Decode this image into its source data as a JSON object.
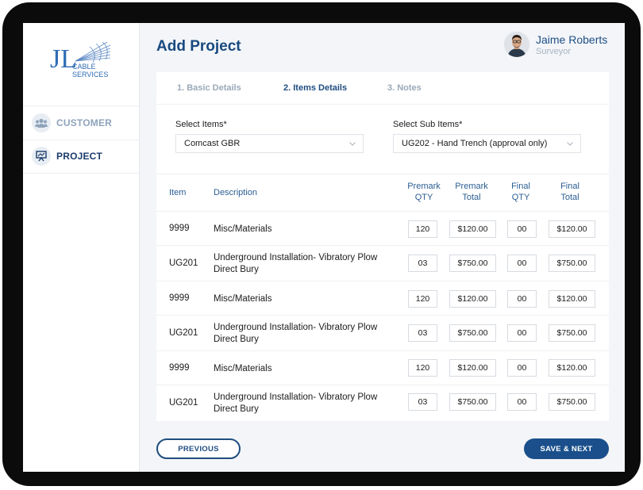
{
  "brand": {
    "logo_letters": "JL",
    "logo_line1": "CABLE",
    "logo_line2": "SERVICES"
  },
  "sidebar": {
    "items": [
      {
        "label": "CUSTOMER",
        "icon": "users-icon"
      },
      {
        "label": "PROJECT",
        "icon": "presentation-icon"
      }
    ]
  },
  "header": {
    "title": "Add Project"
  },
  "user": {
    "name": "Jaime Roberts",
    "role": "Surveyor"
  },
  "tabs": [
    {
      "label": "1. Basic Details"
    },
    {
      "label": "2. Items Details"
    },
    {
      "label": "3. Notes"
    }
  ],
  "form": {
    "items_label": "Select Items*",
    "items_value": "Comcast GBR",
    "subitems_label": "Select Sub Items*",
    "subitems_value": "UG202 - Hand Trench (approval only)"
  },
  "table": {
    "headers": {
      "item": "Item",
      "description": "Description",
      "premark_qty_1": "Premark",
      "premark_qty_2": "QTY",
      "premark_total_1": "Premark",
      "premark_total_2": "Total",
      "final_qty_1": "Final",
      "final_qty_2": "QTY",
      "final_total_1": "Final",
      "final_total_2": "Total"
    },
    "rows": [
      {
        "item": "9999",
        "description": "Misc/Materials",
        "premark_qty": "120",
        "premark_total": "$120.00",
        "final_qty": "00",
        "final_total": "$120.00"
      },
      {
        "item": "UG201",
        "description": "Underground Installation- Vibratory Plow Direct Bury",
        "premark_qty": "03",
        "premark_total": "$750.00",
        "final_qty": "00",
        "final_total": "$750.00"
      },
      {
        "item": "9999",
        "description": "Misc/Materials",
        "premark_qty": "120",
        "premark_total": "$120.00",
        "final_qty": "00",
        "final_total": "$120.00"
      },
      {
        "item": "UG201",
        "description": "Underground Installation- Vibratory Plow Direct Bury",
        "premark_qty": "03",
        "premark_total": "$750.00",
        "final_qty": "00",
        "final_total": "$750.00"
      },
      {
        "item": "9999",
        "description": "Misc/Materials",
        "premark_qty": "120",
        "premark_total": "$120.00",
        "final_qty": "00",
        "final_total": "$120.00"
      },
      {
        "item": "UG201",
        "description": "Underground Installation- Vibratory Plow Direct Bury",
        "premark_qty": "03",
        "premark_total": "$750.00",
        "final_qty": "00",
        "final_total": "$750.00"
      }
    ]
  },
  "buttons": {
    "previous": "PREVIOUS",
    "next": "SAVE & NEXT"
  },
  "colors": {
    "primary": "#1a4f8b",
    "title": "#18497f",
    "muted": "#9aa9b9",
    "header_text": "#2b5e93"
  }
}
